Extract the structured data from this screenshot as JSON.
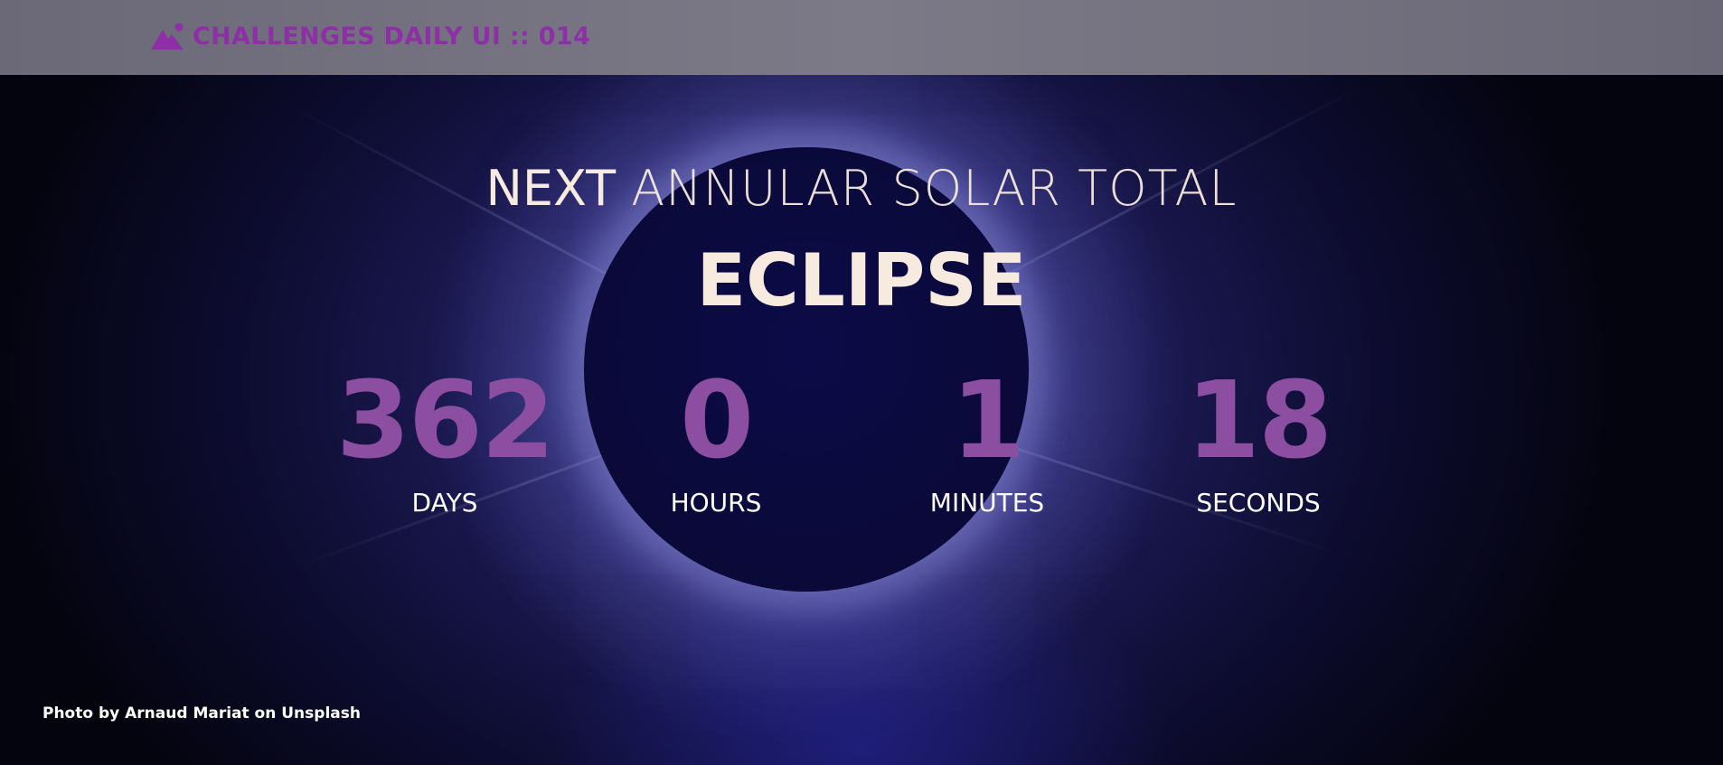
{
  "header": {
    "brand_icon": "mountain-icon",
    "brand_text": "CHALLENGES DAILY UI :: 014",
    "brand_color": "#8e2fa8"
  },
  "hero": {
    "headline_strong": "NEXT",
    "headline_light": "ANNULAR SOLAR TOTAL",
    "title": "ECLIPSE",
    "number_color": "#8c4ea0",
    "text_color": "#f7ebe0"
  },
  "countdown": {
    "days": {
      "value": "362",
      "label": "DAYS"
    },
    "hours": {
      "value": "0",
      "label": "HOURS"
    },
    "minutes": {
      "value": "1",
      "label": "MINUTES"
    },
    "seconds": {
      "value": "18",
      "label": "SECONDS"
    }
  },
  "footer": {
    "credit": "Photo by Arnaud Mariat on Unsplash"
  }
}
